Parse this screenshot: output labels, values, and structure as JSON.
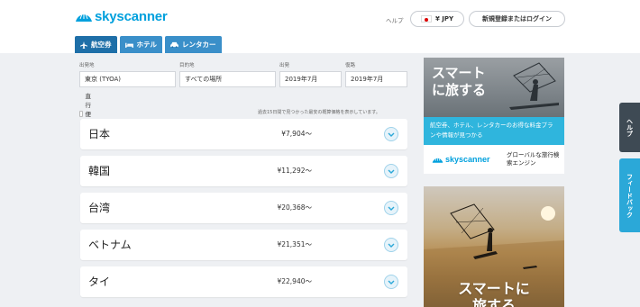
{
  "header": {
    "logo_text": "skyscanner",
    "help": "ヘルプ",
    "currency": "¥ JPY",
    "login": "新規登録またはログイン"
  },
  "tabs": [
    {
      "label": "航空券",
      "icon": "plane-icon"
    },
    {
      "label": "ホテル",
      "icon": "bed-icon"
    },
    {
      "label": "レンタカー",
      "icon": "car-icon"
    }
  ],
  "search": {
    "origin": {
      "label": "出発地",
      "value": "東京 (TYOA)"
    },
    "destination": {
      "label": "目的地",
      "value": "すべての場所"
    },
    "depart": {
      "label": "出発",
      "value": "2019年7月"
    },
    "return": {
      "label": "復路",
      "value": "2019年7月"
    },
    "direct_only": "直行便のみ",
    "note": "過去15日間で見つかった最安の概算価格を表示しています。"
  },
  "results": [
    {
      "name": "日本",
      "price": "¥7,904～"
    },
    {
      "name": "韓国",
      "price": "¥11,292～"
    },
    {
      "name": "台湾",
      "price": "¥20,368～"
    },
    {
      "name": "ベトナム",
      "price": "¥21,351～"
    },
    {
      "name": "タイ",
      "price": "¥22,940～"
    }
  ],
  "ad1": {
    "title": "スマート\nに旅する",
    "body": "航空券、ホテル、レンタカーのお得な料金プランや情報が見つかる",
    "logo_text": "skyscanner",
    "tagline": "グローバルな旅行検索エンジン"
  },
  "ad2": {
    "title": "スマートに\n旅する"
  },
  "side": {
    "help": "ヘルプ",
    "feedback": "フィードバック"
  },
  "colors": {
    "brand": "#00a0dd",
    "tab": "#3a8fc9",
    "tab_active": "#1e6fa8",
    "ad_band": "#2fb5dd",
    "help_tab": "#3e4a54",
    "feedback_tab": "#2ba8d8"
  }
}
